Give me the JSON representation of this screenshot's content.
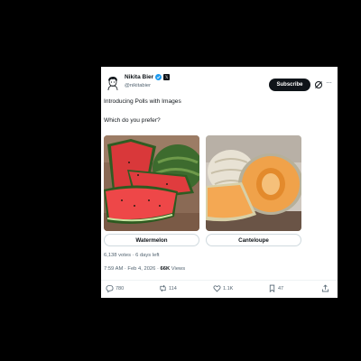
{
  "author": {
    "name": "Nikita Bier",
    "handle": "@nikitabier"
  },
  "header": {
    "subscribe_label": "Subscribe",
    "more_label": "···"
  },
  "tweet": {
    "line1": "Introducing Polls with Images",
    "line2": "Which do you prefer?"
  },
  "poll": {
    "options": [
      {
        "label": "Watermelon",
        "image": "watermelon-photo"
      },
      {
        "label": "Canteloupe",
        "image": "cantaloupe-photo"
      }
    ],
    "meta": "6,138 votes · 6 days left"
  },
  "timestamp": {
    "time_date": "7:59 AM · Feb 4, 2026 · ",
    "views_count": "66K",
    "views_label": " Views"
  },
  "actions": {
    "replies": "780",
    "reposts": "114",
    "likes": "1.1K",
    "bookmarks": "47"
  },
  "colors": {
    "verified": "#1d9bf0",
    "text_primary": "#0f1419",
    "text_secondary": "#536471"
  }
}
